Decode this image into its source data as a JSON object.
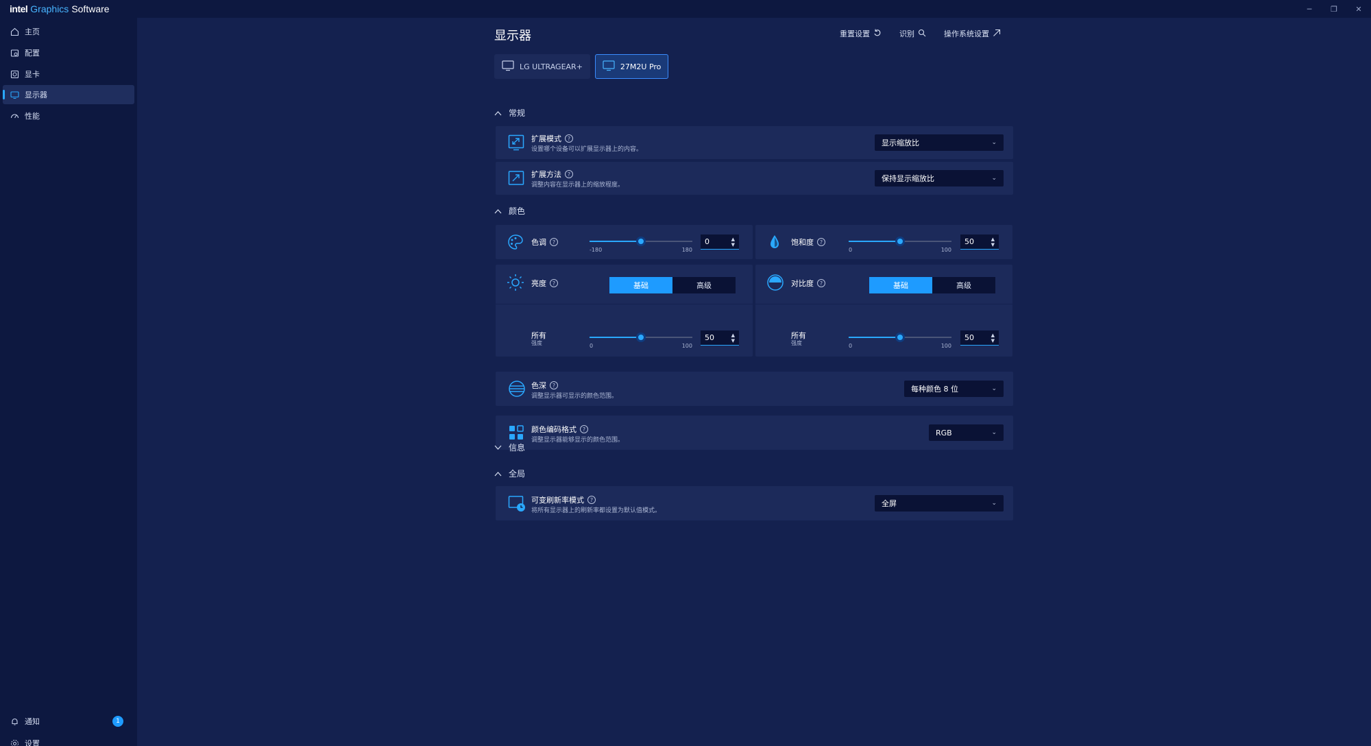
{
  "app": {
    "brand_intel": "intel",
    "brand_graphics": "Graphics",
    "brand_software": "Software"
  },
  "window_controls": {
    "minimize": "─",
    "restore": "❐",
    "close": "✕"
  },
  "sidebar": {
    "items": [
      {
        "label": "主页",
        "icon": "home-icon"
      },
      {
        "label": "配置",
        "icon": "profile-icon"
      },
      {
        "label": "显卡",
        "icon": "gpu-icon"
      },
      {
        "label": "显示器",
        "icon": "display-icon",
        "active": true
      },
      {
        "label": "性能",
        "icon": "performance-icon"
      }
    ],
    "bottom": [
      {
        "label": "通知",
        "icon": "bell-icon",
        "badge": "1"
      },
      {
        "label": "设置",
        "icon": "gear-icon"
      }
    ]
  },
  "header": {
    "title": "显示器",
    "reset_label": "重置设置",
    "identify_label": "识别",
    "os_settings_label": "操作系统设置"
  },
  "monitors": [
    {
      "label": "LG ULTRAGEAR+",
      "active": false
    },
    {
      "label": "27M2U Pro",
      "active": true
    }
  ],
  "sections": {
    "general": {
      "title": "常规",
      "expanded": true
    },
    "color": {
      "title": "颜色",
      "expanded": true
    },
    "info": {
      "title": "信息",
      "expanded": false
    },
    "global": {
      "title": "全局",
      "expanded": true
    }
  },
  "general": {
    "scale_mode": {
      "title": "扩展模式",
      "desc": "设置哪个设备可以扩展显示器上的内容。",
      "value": "显示缩放比"
    },
    "scale_method": {
      "title": "扩展方法",
      "desc": "调整内容在显示器上的缩放程度。",
      "value": "保持显示缩放比"
    }
  },
  "color": {
    "hue": {
      "title": "色调",
      "min": "-180",
      "max": "180",
      "value": "0",
      "fraction": 0.5
    },
    "saturation": {
      "title": "饱和度",
      "min": "0",
      "max": "100",
      "value": "50",
      "fraction": 0.5
    },
    "brightness": {
      "title": "亮度",
      "seg_basic": "基础",
      "seg_advanced": "高级",
      "channel": "所有",
      "channel_sub": "强度",
      "min": "0",
      "max": "100",
      "value": "50",
      "fraction": 0.5
    },
    "contrast": {
      "title": "对比度",
      "seg_basic": "基础",
      "seg_advanced": "高级",
      "channel": "所有",
      "channel_sub": "强度",
      "min": "0",
      "max": "100",
      "value": "50",
      "fraction": 0.5
    },
    "depth": {
      "title": "色深",
      "desc": "调整显示器可显示的颜色范围。",
      "value": "每种颜色 8 位"
    },
    "encoding": {
      "title": "颜色编码格式",
      "desc": "调整显示器能够显示的颜色范围。",
      "value": "RGB"
    }
  },
  "global": {
    "vrr": {
      "title": "可变刷新率模式",
      "desc": "将所有显示器上的刷新率都设置为默认值模式。",
      "value": "全屏"
    }
  },
  "colors": {
    "accent": "#1e9bff",
    "bg": "#14214f",
    "card": "#1c2a5a",
    "sidebar": "#0d1840"
  }
}
